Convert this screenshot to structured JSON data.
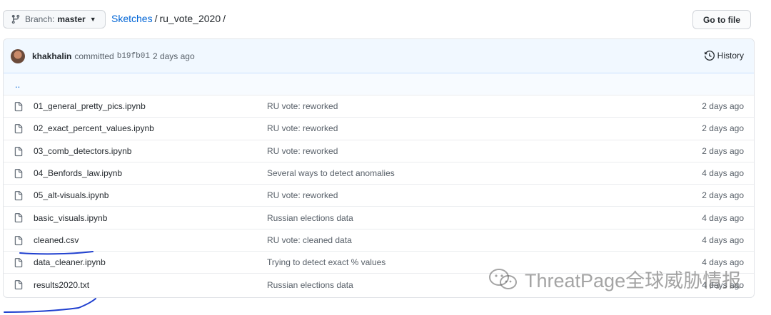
{
  "branch": {
    "prefix": "Branch:",
    "name": "master",
    "icon": "git-branch-icon"
  },
  "breadcrumb": {
    "root": "Sketches",
    "sep1": "/",
    "current": "ru_vote_2020",
    "sep2": "/"
  },
  "goto_file": "Go to file",
  "commit": {
    "author": "khakhalin",
    "verb": "committed",
    "sha": "b19fb01",
    "age": "2 days ago",
    "history_label": "History"
  },
  "parent_dir": "..",
  "files": [
    {
      "name": "01_general_pretty_pics.ipynb",
      "message": "RU vote: reworked",
      "age": "2 days ago"
    },
    {
      "name": "02_exact_percent_values.ipynb",
      "message": "RU vote: reworked",
      "age": "2 days ago"
    },
    {
      "name": "03_comb_detectors.ipynb",
      "message": "RU vote: reworked",
      "age": "2 days ago"
    },
    {
      "name": "04_Benfords_law.ipynb",
      "message": "Several ways to detect anomalies",
      "age": "4 days ago"
    },
    {
      "name": "05_alt-visuals.ipynb",
      "message": "RU vote: reworked",
      "age": "2 days ago"
    },
    {
      "name": "basic_visuals.ipynb",
      "message": "Russian elections data",
      "age": "4 days ago"
    },
    {
      "name": "cleaned.csv",
      "message": "RU vote: cleaned data",
      "age": "4 days ago"
    },
    {
      "name": "data_cleaner.ipynb",
      "message": "Trying to detect exact % values",
      "age": "4 days ago"
    },
    {
      "name": "results2020.txt",
      "message": "Russian elections data",
      "age": "4 days ago"
    }
  ],
  "watermark": "ThreatPage全球威胁情报",
  "colors": {
    "link": "#0366d6",
    "commit_bg": "#f1f8ff",
    "annotation_ink": "#1f3fcf"
  }
}
